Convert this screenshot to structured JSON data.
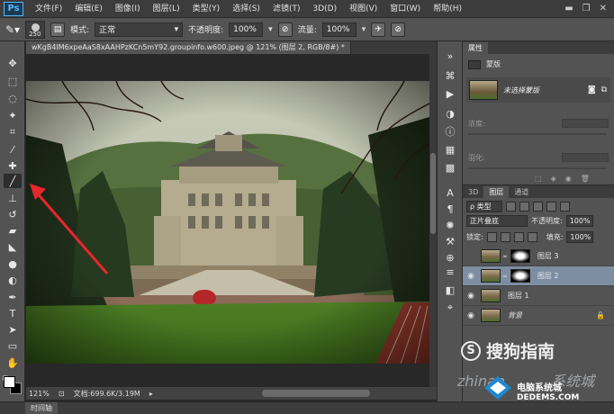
{
  "app": {
    "logo": "Ps"
  },
  "menu": [
    "文件(F)",
    "编辑(E)",
    "图像(I)",
    "图层(L)",
    "类型(Y)",
    "选择(S)",
    "滤镜(T)",
    "3D(D)",
    "视图(V)",
    "窗口(W)",
    "帮助(H)"
  ],
  "window_controls": {
    "minimize": "▬",
    "restore": "❐",
    "close": "✕"
  },
  "options": {
    "brush_size": "250",
    "mode_label": "模式:",
    "mode_value": "正常",
    "opacity_label": "不透明度:",
    "opacity_value": "100%",
    "flow_label": "流量:",
    "flow_value": "100%"
  },
  "document": {
    "tab_title": "wKgB4lM6xpeAaS8xAAHPzKCn5mY92.groupinfo.w600.jpeg @ 121% (图层 2, RGB/8#) *",
    "zoom": "121%",
    "doc_info": "文档:699.6K/3.19M"
  },
  "timeline": {
    "label": "时间轴"
  },
  "properties": {
    "tab": "属性",
    "title": "蒙版",
    "layer_mask_label": "未选择蒙版",
    "density_label": "浓度:",
    "feather_label": "羽化:"
  },
  "layers_panel": {
    "tabs": [
      "3D",
      "图层",
      "通道"
    ],
    "kind_filter": "ρ 类型",
    "blend_mode": "正片叠底",
    "opacity_label": "不透明度:",
    "opacity_value": "100%",
    "lock_label": "锁定:",
    "fill_label": "填充:",
    "fill_value": "100%",
    "layers": [
      {
        "name": "图层 3",
        "visible": false,
        "has_mask": true,
        "selected": false
      },
      {
        "name": "图层 2",
        "visible": true,
        "has_mask": true,
        "selected": true
      },
      {
        "name": "图层 1",
        "visible": true,
        "has_mask": false,
        "selected": false
      },
      {
        "name": "背景",
        "visible": true,
        "has_mask": false,
        "selected": false,
        "locked": true
      }
    ]
  },
  "watermarks": {
    "sogou_symbol": "S",
    "sogou": "搜狗指南",
    "zhinan_domain": "zhinan",
    "xitong": "系统城",
    "site_cn": "电脑系统城",
    "site_url": "DEDEMS.COM"
  },
  "colors": {
    "accent_arrow": "#e8262b",
    "selected_layer": "#7d8ea3"
  }
}
